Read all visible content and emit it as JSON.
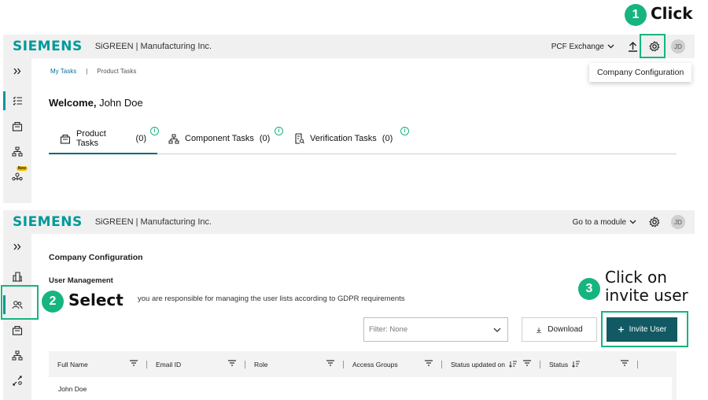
{
  "annotations": {
    "step1": {
      "number": "1",
      "text": "Click"
    },
    "step2": {
      "number": "2",
      "text": "Select"
    },
    "step3": {
      "number": "3",
      "line1": "Click on",
      "line2": "invite user"
    }
  },
  "brand": {
    "logo": "SIEMENS",
    "company": "SiGREEN | Manufacturing Inc."
  },
  "panel1": {
    "module_select": "PCF Exchange",
    "avatar": "JD",
    "settings_menu_item": "Company Configuration",
    "breadcrumb": {
      "item1": "My Tasks",
      "separator": "|",
      "item2": "Product Tasks"
    },
    "welcome_prefix": "Welcome,",
    "welcome_name": "John Doe",
    "tabs": [
      {
        "label": "Product Tasks",
        "count": "(0)"
      },
      {
        "label": "Component Tasks",
        "count": "(0)"
      },
      {
        "label": "Verification Tasks",
        "count": "(0)"
      }
    ],
    "info_glyph": "i",
    "new_badge": "New"
  },
  "panel2": {
    "module_select": "Go to a module",
    "avatar": "JD",
    "section_title": "Company Configuration",
    "subsection_title": "User Management",
    "description": "you are responsible for managing the user lists according to GDPR requirements",
    "filter_placeholder": "Filter: None",
    "download_label": "Download",
    "invite_label": "Invite User",
    "columns": [
      "Full Name",
      "Email ID",
      "Role",
      "Access Groups",
      "Status updated on",
      "Status"
    ],
    "rows": [
      {
        "full_name": "John Doe"
      }
    ]
  },
  "colors": {
    "accent": "#16b57f",
    "brand": "#009999",
    "primary_button": "#125a63"
  }
}
